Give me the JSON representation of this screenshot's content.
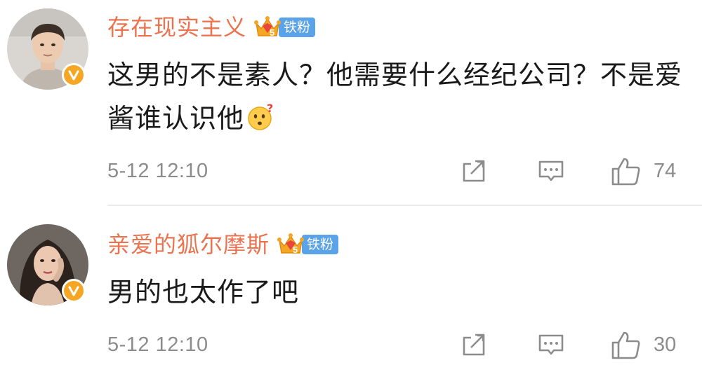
{
  "comments": [
    {
      "username": "存在现实主义",
      "fan_badge": "铁粉",
      "fan_level": "5",
      "text": "这男的不是素人？他需要什么经纪公司？不是爱酱谁认识他",
      "emoji": "question-face-emoji",
      "timestamp": "5-12 12:10",
      "like_count": "74",
      "avatar_icon": "male-user-avatar",
      "verified": true
    },
    {
      "username": "亲爱的狐尔摩斯",
      "fan_badge": "铁粉",
      "fan_level": "5",
      "text": "男的也太作了吧",
      "timestamp": "5-12 12:10",
      "like_count": "30",
      "avatar_icon": "female-user-avatar",
      "verified": true
    }
  ],
  "icons": {
    "share": "share-icon",
    "reply": "comment-icon",
    "like": "thumbs-up-icon",
    "verified": "verified-v-icon",
    "fan_crown": "crown-icon"
  },
  "colors": {
    "username": "#eb7350",
    "fan_badge_bg": "#5aa3e8",
    "crown": "#f5a623",
    "verified": "#f5a623",
    "meta_text": "#8c8c8c",
    "body_text": "#1a1a1a",
    "divider": "#ededed"
  }
}
